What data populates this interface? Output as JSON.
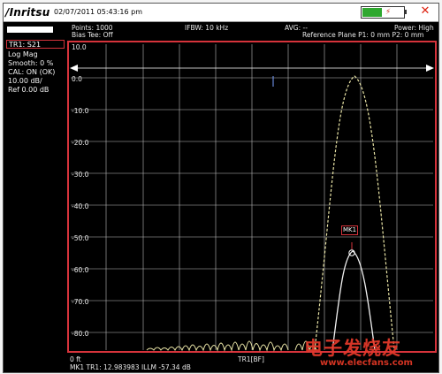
{
  "header": {
    "logo": "/Inritsu",
    "datetime": "02/07/2011 05:43:16 pm",
    "points": "Points: 1000",
    "bias_tee": "Bias Tee: Off",
    "ifbw": "IFBW: 10 kHz",
    "avg": "AVG: --",
    "power": "Power: High",
    "reference_plane": "Reference Plane P1: 0 mm P2: 0 mm",
    "battery_icon": "battery-plugged-icon"
  },
  "trace_panel": {
    "trace": "TR1: S21",
    "format": "Log Mag",
    "smooth": "Smooth: 0 %",
    "cal": "CAL: ON (OK)",
    "scale": "10.00 dB/",
    "ref": "Ref 0.00 dB"
  },
  "graph": {
    "y_labels": [
      "10.0",
      "0.0",
      "-10.0",
      "-20.0",
      "-30.0",
      "-40.0",
      "-50.0",
      "-60.0",
      "-70.0",
      "-80.0"
    ],
    "x_start": "0 ft",
    "x_center": "TR1[BF]",
    "marker_label": "MK1",
    "marker_readout": "MK1 TR1:  12.983983 ILLM -57.34 dB",
    "trace_color": "#e9e4a6",
    "grid_color": "#bdbdbd",
    "border_color": "#d6333b"
  },
  "watermark": {
    "cn": "电子发烧友",
    "url": "www.elecfans.com"
  }
}
